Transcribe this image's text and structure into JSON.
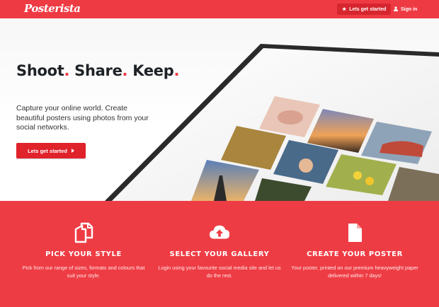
{
  "brand": {
    "logo_text": "Posterista",
    "accent_color": "#ee3a43"
  },
  "nav": {
    "get_started": {
      "icon": "star-icon",
      "label": "Lets get started"
    },
    "sign_in": {
      "icon": "user-icon",
      "label": "Sign in"
    }
  },
  "hero": {
    "title_words": [
      "Shoot",
      "Share",
      "Keep"
    ],
    "title_dot": ".",
    "description": "Capture your online world. Create beautiful posters using photos from your social networks.",
    "cta_label": "Lets get started",
    "cta_icon": "caret-right-icon",
    "image": "framed-photo-collage-poster"
  },
  "features": [
    {
      "icon": "copy-pages-icon",
      "title": "PICK YOUR STYLE",
      "text": "Pick from our range of sizes, formats and colours that suit your style."
    },
    {
      "icon": "cloud-upload-icon",
      "title": "SELECT YOUR GALLERY",
      "text": "Login using your favourite social media site and let us do the rest."
    },
    {
      "icon": "document-icon",
      "title": "CREATE YOUR POSTER",
      "text": "Your poster, printed on our premium heavyweight paper delivered within 7 days!"
    }
  ]
}
